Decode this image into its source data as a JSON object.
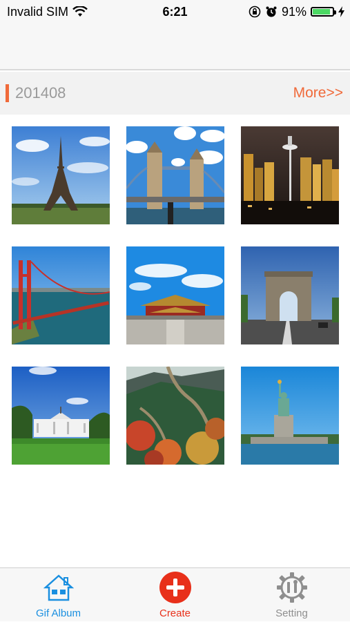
{
  "status_bar": {
    "carrier": "Invalid SIM",
    "time": "6:21",
    "battery_percent": "91%",
    "battery_level": 0.91,
    "icons": [
      "wifi-icon",
      "orientation-lock-icon",
      "alarm-icon",
      "battery-icon",
      "charging-bolt-icon"
    ]
  },
  "section": {
    "title": "201408",
    "more_label": "More>>",
    "accent_color": "#f06a3a"
  },
  "photos": [
    {
      "subject": "Eiffel Tower"
    },
    {
      "subject": "Tower Bridge"
    },
    {
      "subject": "Seattle skyline at night"
    },
    {
      "subject": "Golden Gate Bridge"
    },
    {
      "subject": "Forbidden City"
    },
    {
      "subject": "Arc de Triomphe"
    },
    {
      "subject": "White House"
    },
    {
      "subject": "Great Wall"
    },
    {
      "subject": "Statue of Liberty"
    }
  ],
  "tabbar": {
    "tabs": [
      {
        "label": "Gif Album",
        "icon": "house-icon",
        "color": "#1a8fe0"
      },
      {
        "label": "Create",
        "icon": "plus-circle-icon",
        "color": "#e8301a"
      },
      {
        "label": "Setting",
        "icon": "gear-tools-icon",
        "color": "#8e8e8e"
      }
    ]
  }
}
